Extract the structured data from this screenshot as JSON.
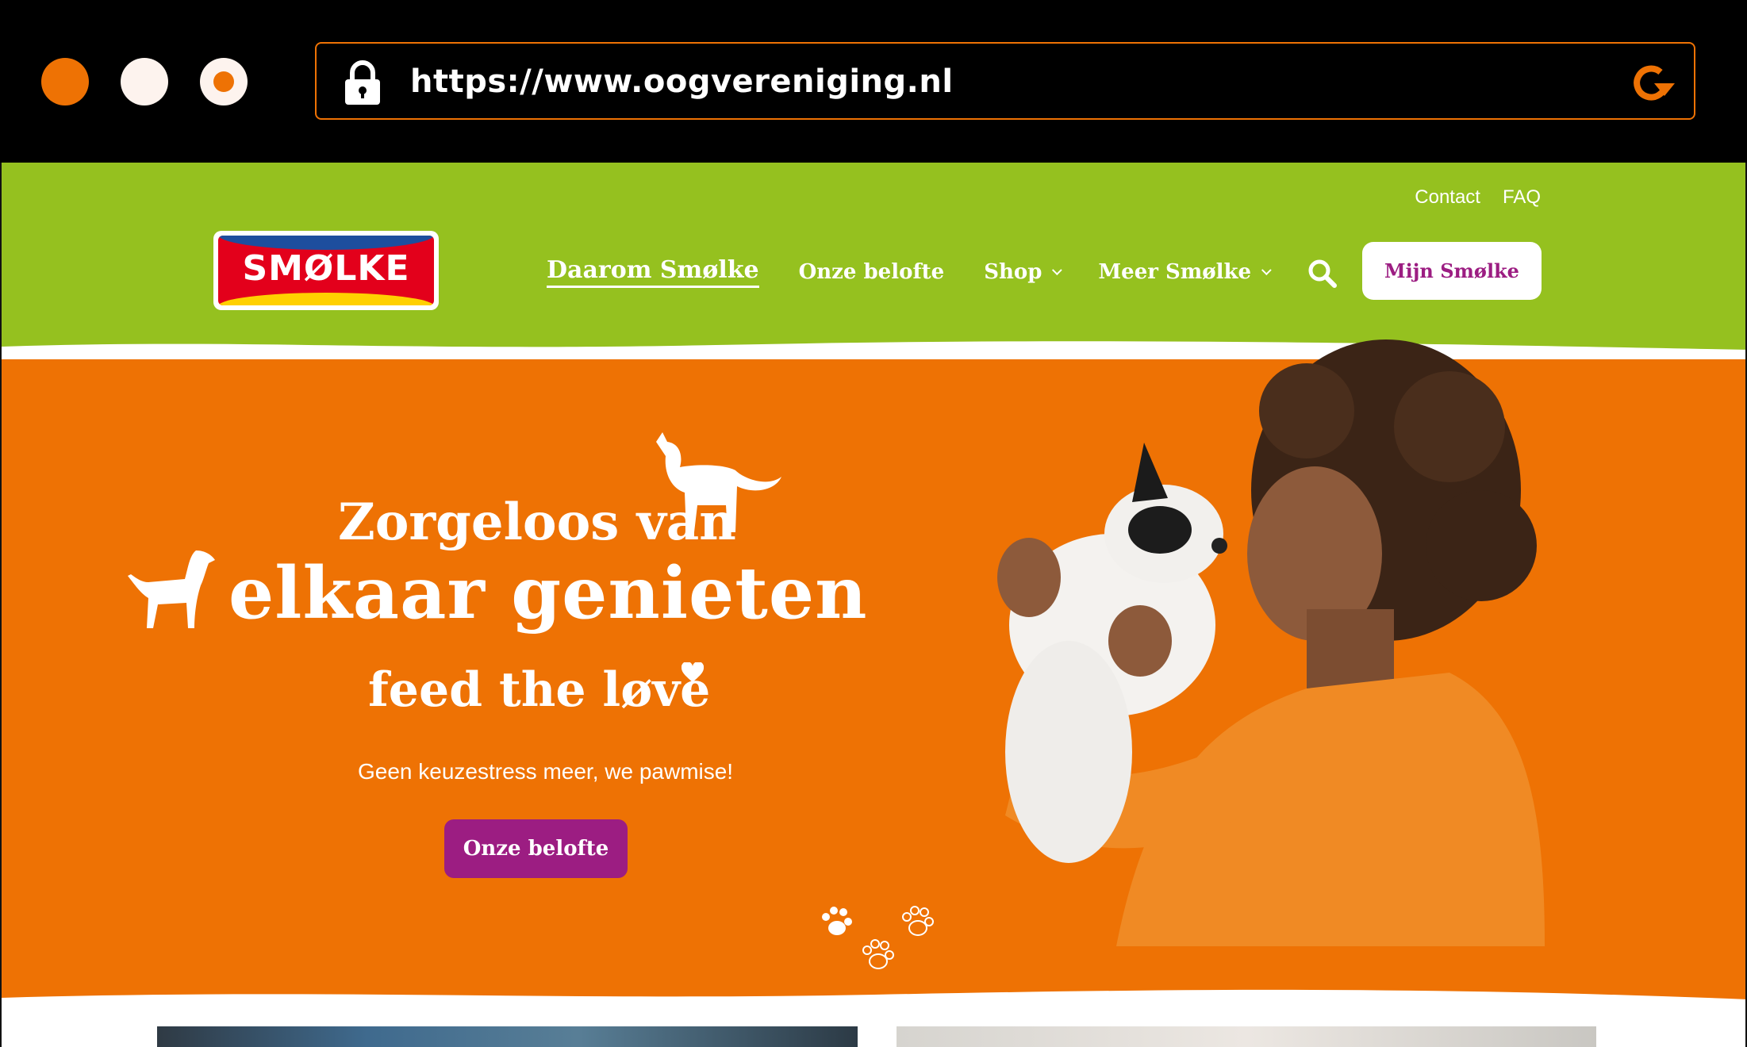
{
  "browser": {
    "url": "https://www.oogvereniging.nl",
    "colors": {
      "accent": "#ee7204",
      "chrome_bg": "#000000"
    }
  },
  "site": {
    "top_links": [
      "Contact",
      "FAQ"
    ],
    "logo_text": "SMØLKE",
    "nav": [
      {
        "label": "Daarom Smølke",
        "active": true,
        "dropdown": false
      },
      {
        "label": "Onze belofte",
        "active": false,
        "dropdown": false
      },
      {
        "label": "Shop",
        "active": false,
        "dropdown": true
      },
      {
        "label": "Meer Smølke",
        "active": false,
        "dropdown": true
      }
    ],
    "account_button": "Mijn Smølke",
    "colors": {
      "header_green": "#95c11f",
      "hero_orange": "#ee7204",
      "cta_purple": "#9c1d82"
    }
  },
  "hero": {
    "headline_line1": "Zorgeloos van",
    "headline_line2": "elkaar genieten",
    "tagline": "feed the løve",
    "subtitle": "Geen keuzestress meer, we pawmise!",
    "cta_label": "Onze belofte"
  }
}
